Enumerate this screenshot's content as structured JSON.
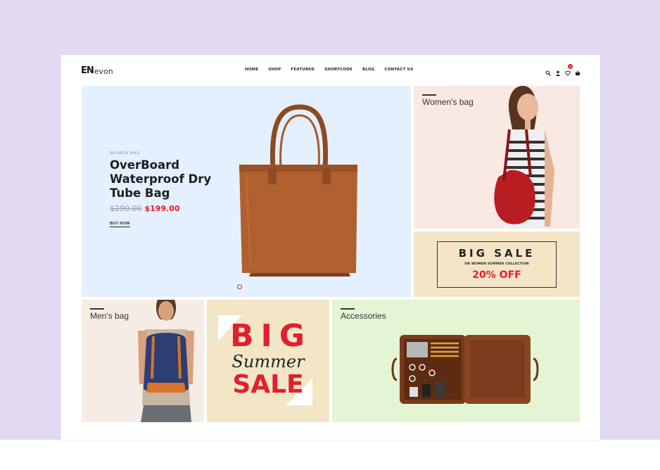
{
  "brand": {
    "mark": "EN",
    "name": "evon"
  },
  "nav": [
    "HOME",
    "SHOP",
    "FEATURED",
    "SHORTCODE",
    "BLOG",
    "CONTACT US"
  ],
  "header_icons": [
    "search-icon",
    "user-icon",
    "heart-icon",
    "cart-icon"
  ],
  "cart_count": "0",
  "hero": {
    "category": "WOMEN BAG",
    "title": "OverBoard Waterproof Dry Tube Bag",
    "old_price": "$290.00",
    "new_price": "$199.00",
    "cta": "BUY NOW",
    "slides": 1
  },
  "tiles": {
    "women": "Women's bag",
    "men": "Men's bag",
    "accessories": "Accessories"
  },
  "big_sale": {
    "title": "BIG SALE",
    "subtitle": "ON WOMEN SUMMER COLLECTION",
    "discount": "20% OFF"
  },
  "summer_sale": {
    "line1": "BIG",
    "line2": "Summer",
    "line3": "SALE"
  },
  "colors": {
    "accent": "#e0202b",
    "background": "#e3d9f3",
    "hero_bg": "#e4f0fd"
  }
}
